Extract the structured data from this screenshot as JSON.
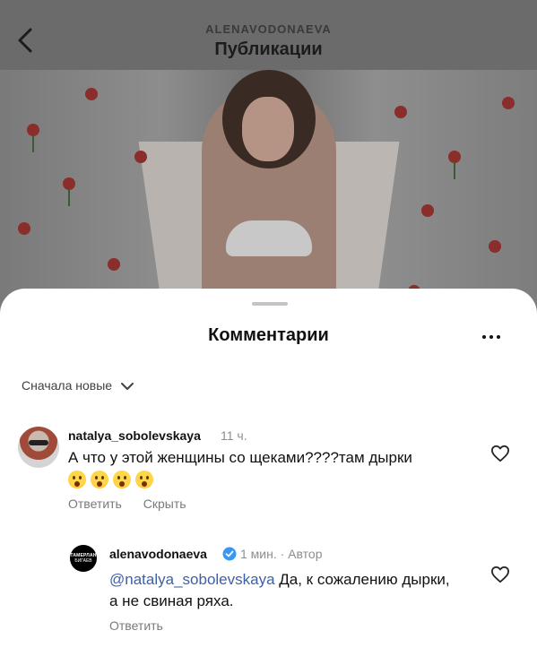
{
  "header": {
    "username": "ALENAVODONAEVA",
    "title": "Публикации"
  },
  "comments_sheet": {
    "title": "Комментарии",
    "sort_label": "Сначала новые"
  },
  "comments": [
    {
      "username": "natalya_sobolevskaya",
      "time": "11 ч.",
      "text": "А что у этой женщины со щеками????там дырки",
      "emoji_count": 4,
      "reply_label": "Ответить",
      "hide_label": "Скрыть"
    },
    {
      "username": "alenavodonaeva",
      "verified": true,
      "meta": "1 мин. · Автор",
      "mention": "@natalya_sobolevskaya",
      "text": " Да, к сожалению дырки, а не свиная ряха.",
      "reply_label": "Ответить",
      "avatar_line1": "ТАМЕРЛАН",
      "avatar_line2": "БИГАЕВ"
    }
  ],
  "colors": {
    "mention": "#3f5fa6",
    "verified": "#3897f0",
    "secondary_text": "#8e8e8e"
  }
}
